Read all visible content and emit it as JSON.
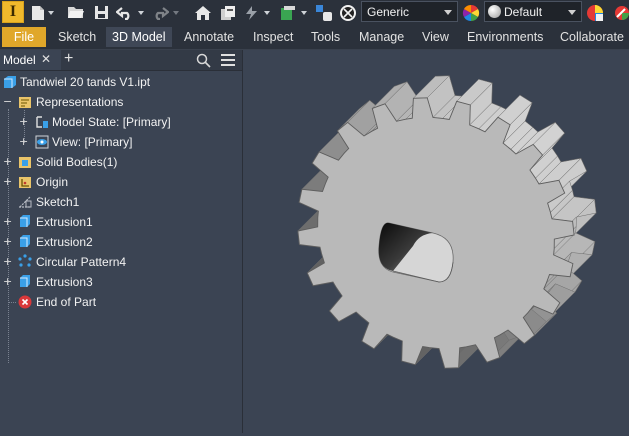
{
  "quick_access": {
    "app_logo": "I",
    "appearance_dropdown": "Generic",
    "material_dropdown": "Default"
  },
  "ribbon": {
    "file_label": "File",
    "tabs": [
      "Sketch",
      "3D Model",
      "Annotate",
      "Inspect",
      "Tools",
      "Manage",
      "View",
      "Environments",
      "Collaborate"
    ],
    "active_tab": "3D Model"
  },
  "browser": {
    "tab_label": "Model",
    "close_glyph": "✕",
    "add_glyph": "+",
    "root": "Tandwiel 20 tands V1.ipt",
    "items": [
      {
        "label": "Representations"
      },
      {
        "label": "Model State: [Primary]"
      },
      {
        "label": "View: [Primary]"
      },
      {
        "label": "Solid Bodies(1)"
      },
      {
        "label": "Origin"
      },
      {
        "label": "Sketch1"
      },
      {
        "label": "Extrusion1"
      },
      {
        "label": "Extrusion2"
      },
      {
        "label": "Circular Pattern4"
      },
      {
        "label": "Extrusion3"
      },
      {
        "label": "End of Part"
      }
    ]
  },
  "colors": {
    "accent_file": "#e0a72a",
    "panel_bg": "#3b4453",
    "toolbar_bg": "#2b313b",
    "gear_face": "#b9b9b9",
    "end_of_part_icon": "#d9383a"
  }
}
